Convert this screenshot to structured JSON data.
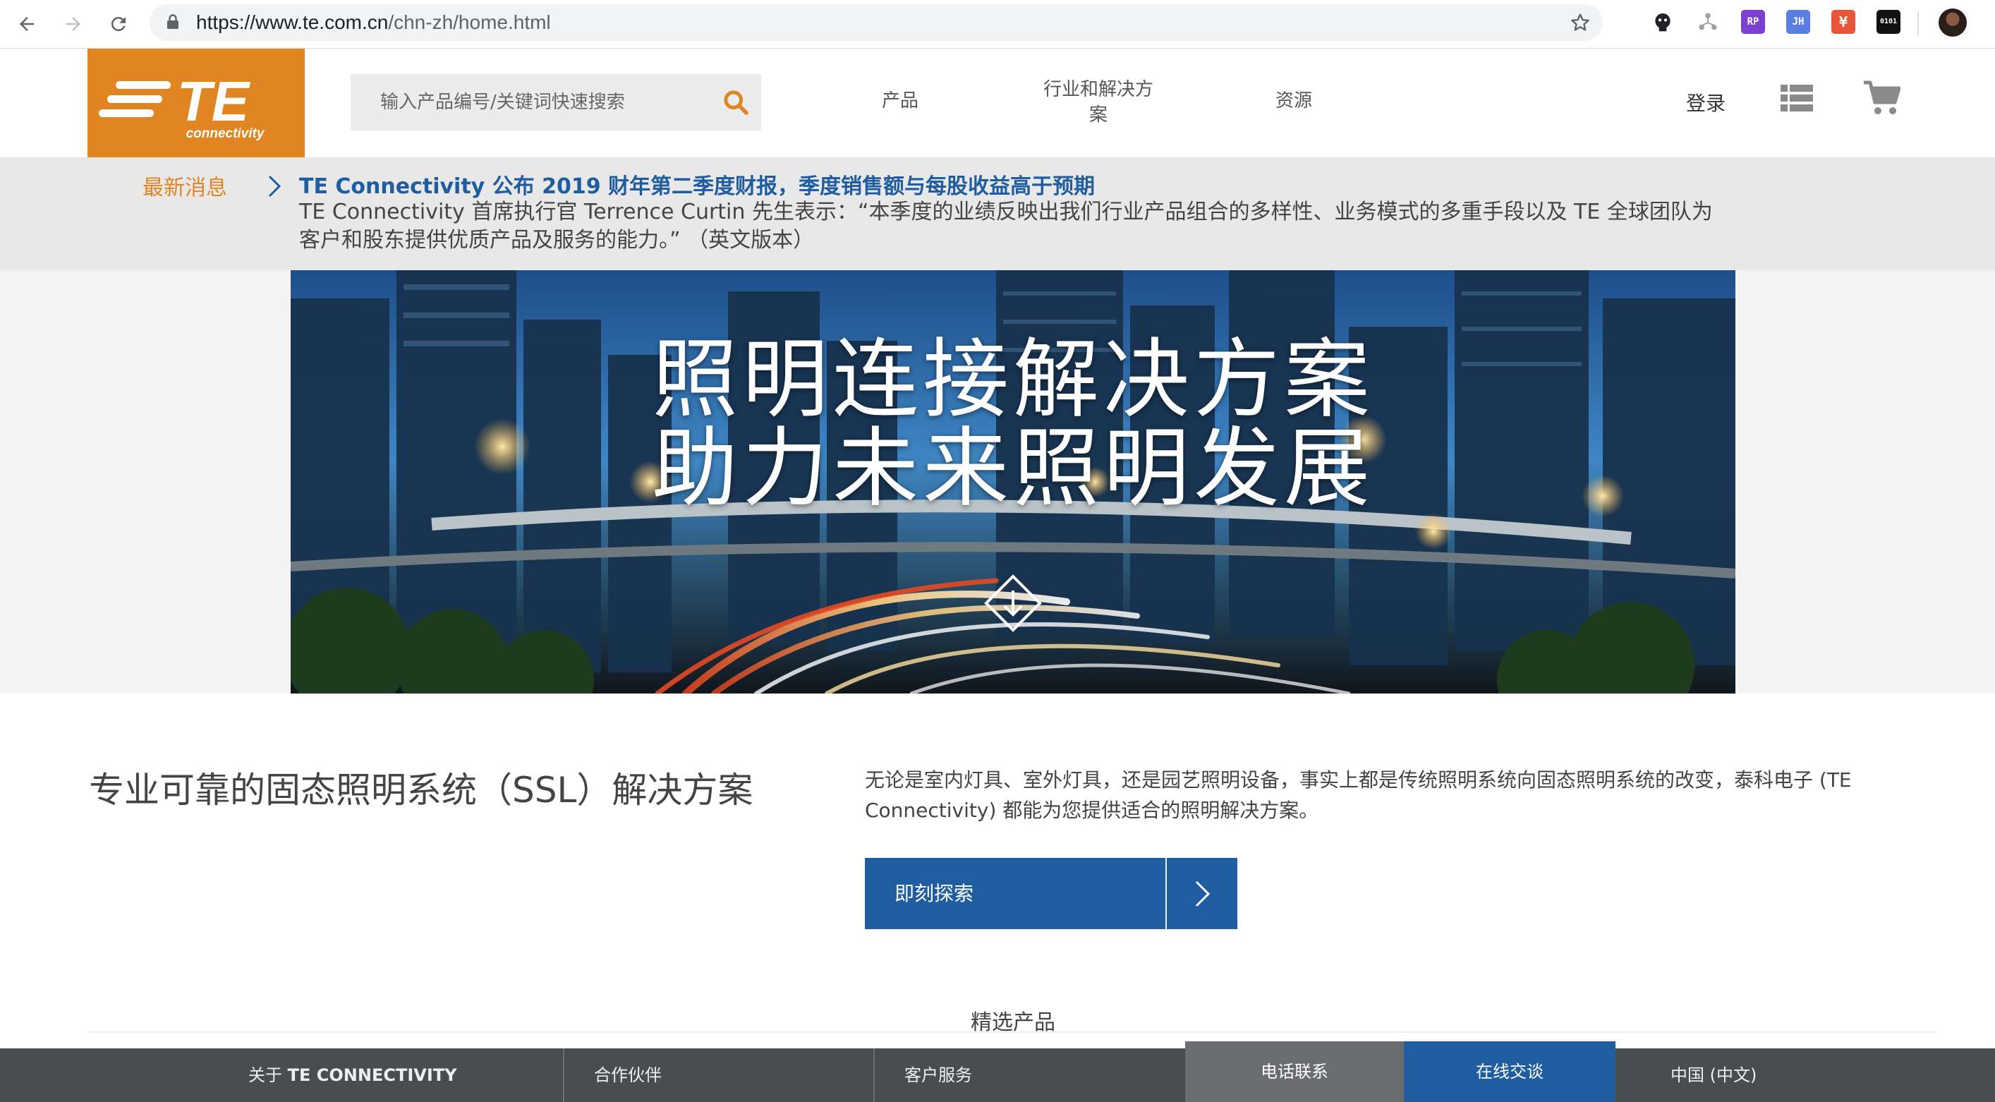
{
  "browser": {
    "url_host": "https://www.te.com.cn",
    "url_path": "/chn-zh/home.html",
    "extensions": [
      {
        "icon": "octocat-icon",
        "color": "#202124"
      },
      {
        "icon": "network-icon",
        "color": "#9aa0a6"
      },
      {
        "icon": "rp-extension-icon",
        "label": "RP",
        "color": "#7b3fd1"
      },
      {
        "icon": "jh-extension-icon",
        "label": "JH",
        "color": "#5b7fe0"
      },
      {
        "icon": "translate-extension-icon",
        "label": "¥",
        "color": "#e8553a"
      },
      {
        "icon": "binary-extension-icon",
        "label": "0101",
        "color": "#111111"
      }
    ]
  },
  "header": {
    "logo_text": "TE",
    "logo_subtext": "connectivity",
    "search_placeholder": "输入产品编号/关键词快速搜索",
    "nav": {
      "products": "产品",
      "industries_line1": "行业和解决方",
      "industries_line2": "案",
      "resources": "资源"
    },
    "login": "登录"
  },
  "news": {
    "label": "最新消息",
    "title": "TE Connectivity 公布 2019 财年第二季度财报，季度销售额与每股收益高于预期",
    "body_line1": "TE Connectivity 首席执行官 Terrence Curtin 先生表示：“本季度的业绩反映出我们行业产品组合的多样性、业务模式的多重手段以及 TE 全球团队为",
    "body_line2": "客户和股东提供优质产品及服务的能力。” （英文版本）"
  },
  "hero": {
    "line1": "照明连接解决方案",
    "line2": "助力未来照明发展"
  },
  "content": {
    "title": "专业可靠的固态照明系统（SSL）解决方案",
    "desc_line1": "无论是室内灯具、室外灯具，还是园艺照明设备，事实上都是传统照明系统向固态照明系统的改变，泰科电子 (TE",
    "desc_line2": "Connectivity) 都能为您提供适合的照明解决方案。",
    "cta": "即刻探索",
    "featured": "精选产品"
  },
  "footer": {
    "about_prefix": "关于 ",
    "about_brand": "TE CONNECTIVITY",
    "partners": "合作伙伴",
    "service": "客户服务",
    "phone": "电话联系",
    "chat": "在线交谈",
    "region": "中国 (中文)"
  },
  "colors": {
    "brand_orange": "#e08522",
    "brand_blue": "#1f5da0",
    "footer_gray": "#4a4d50"
  }
}
